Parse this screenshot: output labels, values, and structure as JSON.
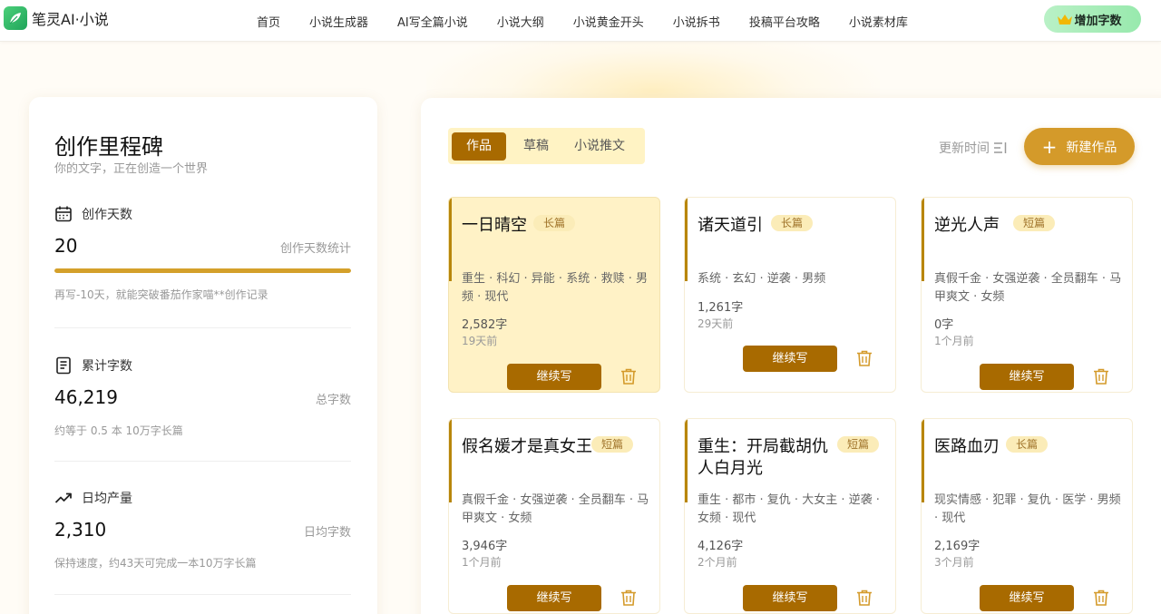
{
  "nav": {
    "brand": "笔灵AI·小说",
    "links": [
      "首页",
      "小说生成器",
      "AI写全篇小说",
      "小说大纲",
      "小说黄金开头",
      "小说拆书",
      "投稿平台攻略",
      "小说素材库"
    ],
    "cta_label": "增加字数"
  },
  "milestone": {
    "title": "创作里程碑",
    "subtitle": "你的文字，正在创造一个世界",
    "stats": [
      {
        "label": "创作天数",
        "value": "20",
        "aside": "创作天数统计",
        "note": "再写-10天，就能突破番茄作家喵**创作记录",
        "progress": 1.0
      },
      {
        "label": "累计字数",
        "value": "46,219",
        "aside": "总字数",
        "note": "约等于 0.5 本 10万字长篇"
      },
      {
        "label": "日均产量",
        "value": "2,310",
        "aside": "日均字数",
        "note": "保持速度，约43天可完成一本10万字长篇"
      }
    ]
  },
  "works": {
    "tabs": [
      "作品",
      "草稿",
      "小说推文"
    ],
    "active_tab": "作品",
    "sort_label": "更新时间",
    "new_button": "新建作品",
    "continue_label": "继续写",
    "cards": [
      {
        "title": "一日晴空",
        "badge": "长篇",
        "tags": "重生 · 科幻 · 异能 · 系统 · 救赎 · 男频 · 现代",
        "words": "2,582字",
        "time": "19天前",
        "highlight": true
      },
      {
        "title": "诸天道引",
        "badge": "长篇",
        "tags": "系统 · 玄幻 · 逆袭 · 男频",
        "words": "1,261字",
        "time": "29天前",
        "highlight": false
      },
      {
        "title": "逆光人声",
        "badge": "短篇",
        "tags": "真假千金 · 女强逆袭 · 全员翻车 · 马甲爽文 · 女频",
        "words": "0字",
        "time": "1个月前",
        "highlight": false
      },
      {
        "title": "假名媛才是真女王",
        "badge": "短篇",
        "tags": "真假千金 · 女强逆袭 · 全员翻车 · 马甲爽文 · 女频",
        "words": "3,946字",
        "time": "1个月前",
        "highlight": false
      },
      {
        "title": "重生：开局截胡仇人白月光",
        "badge": "短篇",
        "tags": "重生 · 都市 · 复仇 · 大女主 · 逆袭 · 女频 · 现代",
        "words": "4,126字",
        "time": "2个月前",
        "highlight": false
      },
      {
        "title": "医路血刃",
        "badge": "长篇",
        "tags": "现实情感 · 犯罪 · 复仇 · 医学 · 男频 · 现代",
        "words": "2,169字",
        "time": "3个月前",
        "highlight": false
      }
    ]
  },
  "colors": {
    "accent": "#a86a00",
    "accent_light": "#d49a2a",
    "badge_bg": "#fbecb8",
    "highlight_card": "#fff2c6",
    "green_cta": "#98e9ad"
  },
  "icons": [
    "leaf-logo-icon",
    "crown-icon",
    "calendar-icon",
    "document-icon",
    "trending-up-icon",
    "sort-icon",
    "plus-icon",
    "trash-icon"
  ]
}
